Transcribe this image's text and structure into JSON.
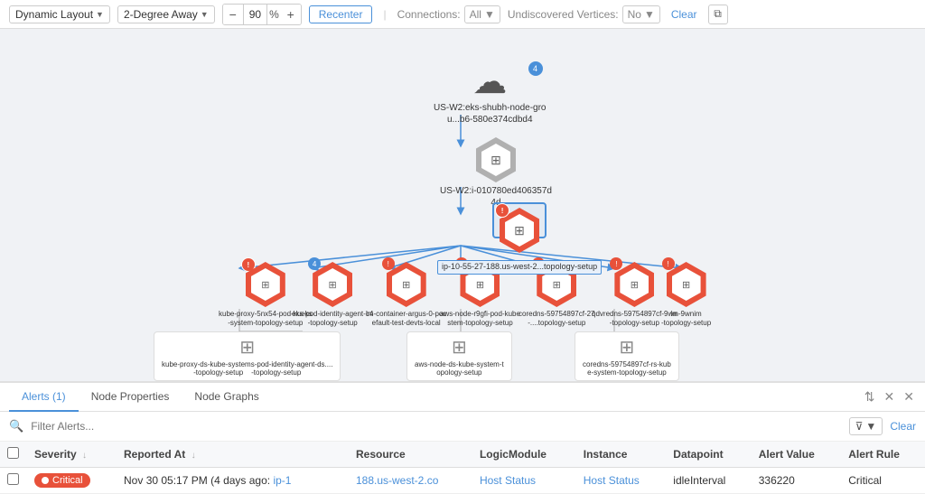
{
  "toolbar": {
    "layout_label": "Dynamic Layout",
    "degree_label": "2-Degree Away",
    "zoom_value": "90",
    "zoom_pct": "%",
    "zoom_minus": "−",
    "zoom_plus": "+",
    "recenter_label": "Recenter",
    "connections_label": "Connections:",
    "connections_value": "All",
    "undiscovered_label": "Undiscovered Vertices:",
    "undiscovered_value": "No",
    "clear_label": "Clear",
    "expand_icon": "⧉"
  },
  "graph": {
    "nodes": [
      {
        "id": "cloud",
        "label": "US-W2:eks-shubh-node-gro\nu...b6-580e374cdbd4",
        "type": "cloud"
      },
      {
        "id": "server",
        "label": "US-W2:i-010780ed406357d\n4d",
        "type": "server"
      },
      {
        "id": "center",
        "label": "ip-10-55-27-188.us-west-2...topology-setup",
        "type": "hex-center"
      },
      {
        "id": "h1",
        "label": "kube-proxy-5nx54-pod-ku\n-system-topology-setup",
        "type": "hex"
      },
      {
        "id": "h2",
        "label": "eks-pod-identity-agent-c4\n-topology-setup",
        "type": "hex"
      },
      {
        "id": "h3",
        "label": "lm-container-argus-0-poc\nefault-test-devts-local",
        "type": "hex"
      },
      {
        "id": "h4",
        "label": "aws-node-r9gfi-pod-kube\nstem-topology-setup",
        "type": "hex"
      },
      {
        "id": "h5",
        "label": "coredns-59754897cf-27\n-....topology-setup",
        "type": "hex"
      },
      {
        "id": "h6",
        "label": "qdvredns-59754897cf-9wn\n-topology-setup",
        "type": "hex"
      },
      {
        "id": "ds1",
        "label": "kube-proxy-ds-kube-systems-pod-identity-agent-ds....\n-topology-setup      -topology-setup",
        "type": "ds"
      },
      {
        "id": "ds2",
        "label": "aws-node-ds-kube-system-t\nopology-setup",
        "type": "ds"
      },
      {
        "id": "ds3",
        "label": "coredns-59754897cf-rs-kub\ne-system-topology-setup",
        "type": "ds"
      }
    ]
  },
  "tabs": [
    {
      "id": "alerts",
      "label": "Alerts (1)",
      "active": true
    },
    {
      "id": "node-props",
      "label": "Node Properties",
      "active": false
    },
    {
      "id": "node-graphs",
      "label": "Node Graphs",
      "active": false
    }
  ],
  "tab_actions": {
    "collapse_icon": "⇅",
    "pin_icon": "×",
    "close_icon": "×"
  },
  "filter": {
    "placeholder": "Filter Alerts...",
    "clear_label": "Clear"
  },
  "table": {
    "columns": [
      "",
      "Severity",
      "Reported At",
      "Resource",
      "LogicModule",
      "Instance",
      "Datapoint",
      "Alert Value",
      "Alert Rule"
    ],
    "rows": [
      {
        "checkbox": false,
        "severity": "Critical",
        "reported_at": "Nov 30 05:17 PM (4 days ago:",
        "resource_link": "ip-1",
        "resource_suffix": "",
        "logicmodule_link": "188.us-west-2.co",
        "logicmodule_text": "Host Status",
        "instance_link": "Host Status",
        "datapoint": "idleInterval",
        "alert_value": "336220",
        "alert_rule": "Critical"
      }
    ]
  }
}
